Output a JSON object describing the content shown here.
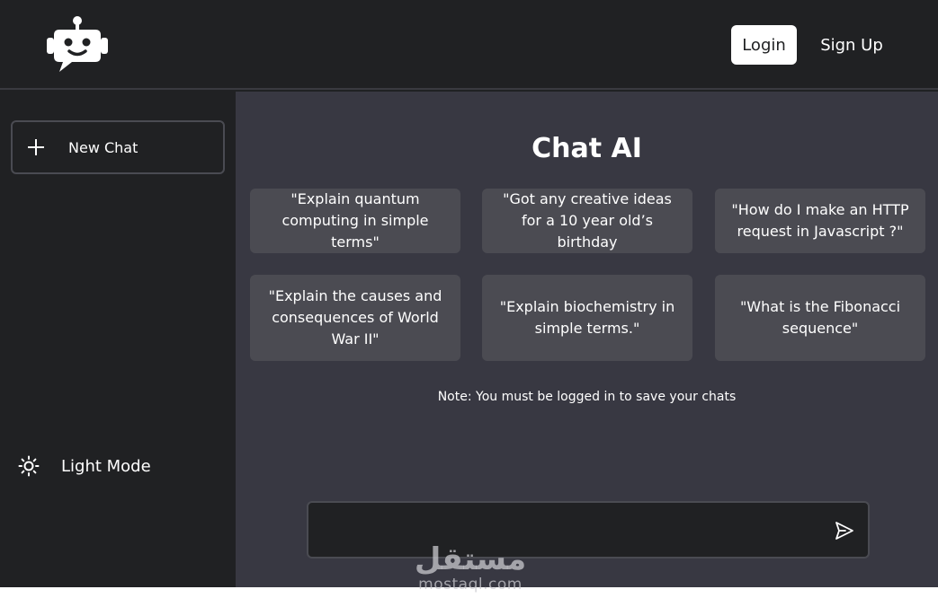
{
  "header": {
    "logo_icon": "robot-chat-icon",
    "login_label": "Login",
    "signup_label": "Sign Up"
  },
  "sidebar": {
    "new_chat_label": "New Chat",
    "new_chat_icon": "plus-icon",
    "light_mode_label": "Light Mode",
    "light_mode_icon": "sun-icon"
  },
  "main": {
    "title": "Chat AI",
    "suggestions": [
      "\"Explain quantum computing in simple terms\"",
      "\"Got any creative ideas for a 10 year old’s birthday",
      "\"How do I make an HTTP request in Javascript ?\"",
      "\"Explain the causes and consequences of World War II\"",
      "\"Explain biochemistry in simple terms.\"",
      "\"What is the Fibonacci sequence\""
    ],
    "note": "Note: You must be logged in to save your chats",
    "input_value": "",
    "send_icon": "send-icon"
  },
  "watermark": {
    "arabic": "مستقل",
    "latin": "mostaql.com"
  },
  "colors": {
    "sidebar_bg": "#202123",
    "main_bg": "#383842",
    "card_bg": "#4b4b52",
    "border": "#4a4b52"
  }
}
